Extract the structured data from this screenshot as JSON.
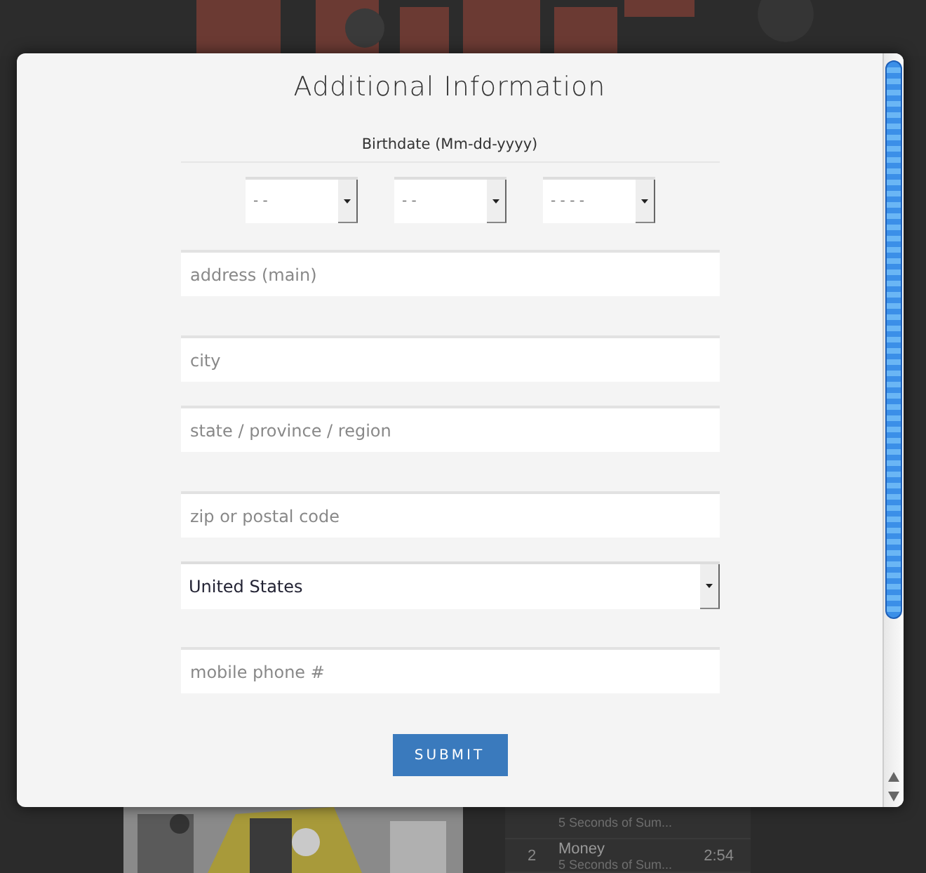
{
  "background": {
    "tracks": [
      {
        "artist": "5 Seconds of Sum..."
      },
      {
        "number": "2",
        "title": "Money",
        "artist": "5 Seconds of Sum...",
        "duration": "2:54"
      }
    ]
  },
  "dialog": {
    "title": "Additional Information",
    "birthdate_label": "Birthdate (Mm-dd-yyyy)",
    "birthdate_selects": [
      {
        "value": "- -"
      },
      {
        "value": "- -"
      },
      {
        "value": "- - - -"
      }
    ],
    "fields": [
      {
        "kind": "input",
        "placeholder": "address (main)"
      },
      {
        "kind": "input",
        "placeholder": "city"
      },
      {
        "kind": "input",
        "placeholder": "state / province / region"
      },
      {
        "kind": "input",
        "placeholder": "zip or postal code"
      },
      {
        "kind": "select",
        "value": "United States"
      },
      {
        "kind": "input",
        "placeholder": "mobile phone #"
      }
    ],
    "submit": "SUBMIT"
  }
}
